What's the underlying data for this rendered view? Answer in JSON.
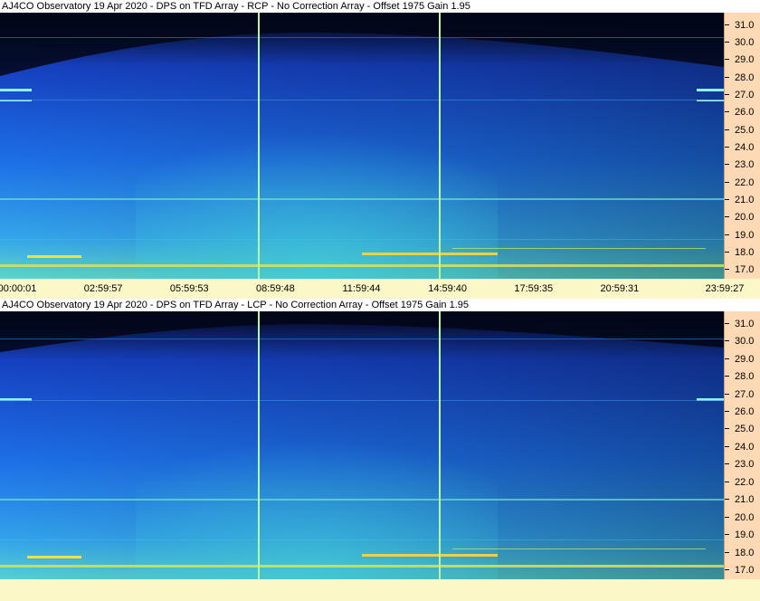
{
  "panels": [
    {
      "title": "AJ4CO Observatory 19 Apr 2020 - DPS on TFD Array  - RCP  -  No Correction Array  -  Offset 1975  Gain 1.95"
    },
    {
      "title": "AJ4CO Observatory 19 Apr 2020 - DPS on TFD Array  - LCP  -  No Correction Array  -  Offset 1975  Gain 1.95"
    }
  ],
  "y_axis": {
    "labels": [
      "31.0",
      "30.0",
      "29.0",
      "28.0",
      "27.0",
      "26.0",
      "25.0",
      "24.0",
      "23.0",
      "22.0",
      "21.0",
      "20.0",
      "19.0",
      "18.0",
      "17.0"
    ],
    "min_mhz": 16.5,
    "max_mhz": 31.7
  },
  "x_axis": {
    "labels": [
      "00:00:01",
      "02:59:57",
      "05:59:53",
      "08:59:48",
      "11:59:44",
      "14:59:40",
      "17:59:35",
      "20:59:31",
      "23:59:27"
    ]
  },
  "colors": {
    "spectrogram_dark": "#020a1e",
    "spectrogram_blue": "#1a4fe0",
    "spectrogram_cyan": "#3aaee8",
    "spectrogram_green": "#6ee8a0",
    "marker_line": "#b6f7a0",
    "yaxis_bg": "#fdd9b5",
    "xaxis_bg": "#fbf7c6"
  }
}
